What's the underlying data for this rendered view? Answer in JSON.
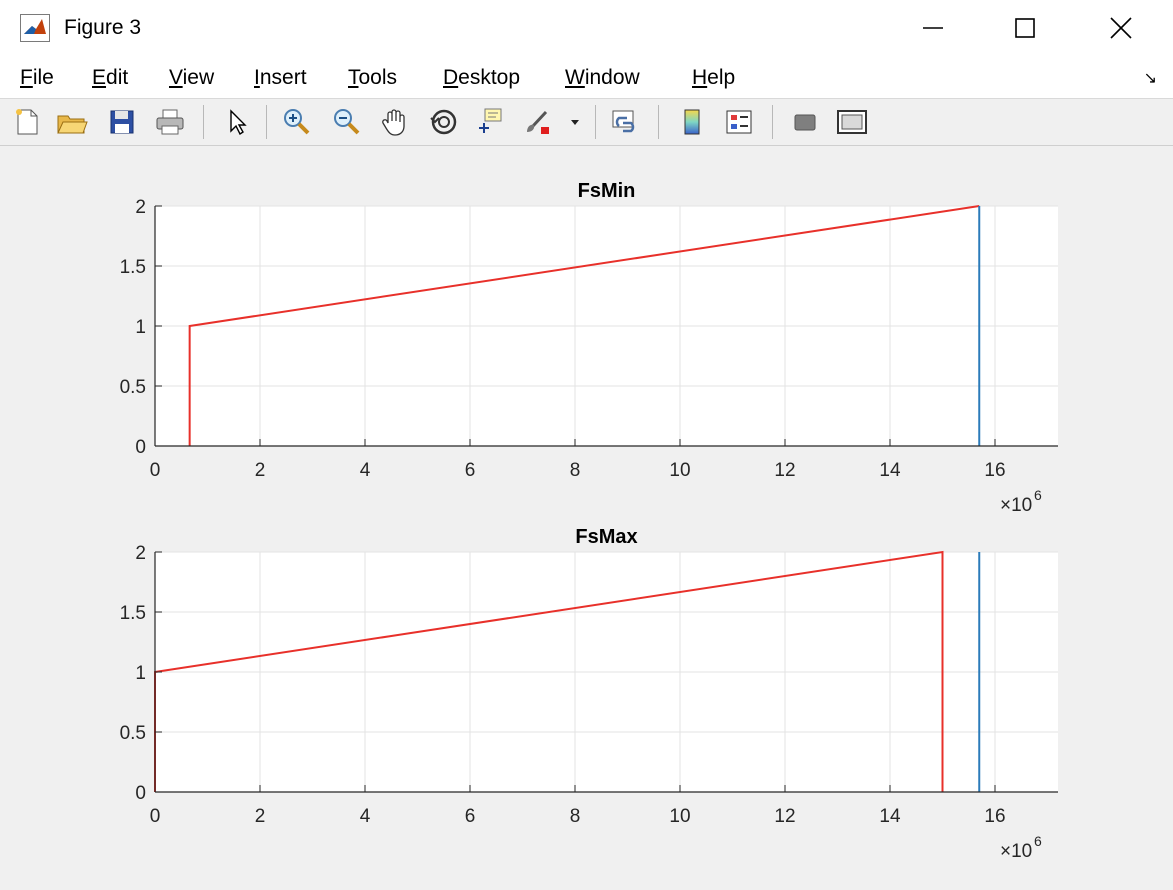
{
  "window": {
    "title": "Figure 3"
  },
  "menu": {
    "items": [
      {
        "first": "F",
        "rest": "ile"
      },
      {
        "first": "E",
        "rest": "dit"
      },
      {
        "first": "V",
        "rest": "iew"
      },
      {
        "first": "I",
        "rest": "nsert"
      },
      {
        "first": "T",
        "rest": "ools"
      },
      {
        "first": "D",
        "rest": "esktop"
      },
      {
        "first": "W",
        "rest": "indow"
      },
      {
        "first": "H",
        "rest": "elp"
      }
    ]
  },
  "toolbar": {
    "tools": [
      "new-figure-icon",
      "open-file-icon",
      "save-icon",
      "print-icon",
      "pointer-icon",
      "zoom-in-icon",
      "zoom-out-icon",
      "pan-hand-icon",
      "rotate-3d-icon",
      "data-cursor-icon",
      "brush-icon",
      "brush-dropdown-icon",
      "link-plot-icon",
      "colorbar-icon",
      "legend-icon",
      "hide-plot-tools-icon",
      "show-plot-tools-icon"
    ]
  },
  "colors": {
    "red_series": "#e8302a",
    "blue_series": "#2b7bba"
  },
  "chart_data": [
    {
      "type": "line",
      "title": "FsMin",
      "xlabel": "",
      "ylabel": "",
      "xlim": [
        0,
        17200000
      ],
      "ylim": [
        0,
        2
      ],
      "xticks": [
        0,
        2000000,
        4000000,
        6000000,
        8000000,
        10000000,
        12000000,
        14000000,
        16000000
      ],
      "xtick_labels": [
        "0",
        "2",
        "4",
        "6",
        "8",
        "10",
        "12",
        "14",
        "16"
      ],
      "yticks": [
        0,
        0.5,
        1,
        1.5,
        2
      ],
      "ytick_labels": [
        "0",
        "0.5",
        "1",
        "1.5",
        "2"
      ],
      "exponent_label": "×10",
      "exponent_power": "6",
      "grid": true,
      "series": [
        {
          "color": "red",
          "x": [
            660000,
            660000,
            15700000
          ],
          "y": [
            0,
            1,
            2
          ]
        },
        {
          "color": "blue",
          "x": [
            15700000,
            15700000
          ],
          "y": [
            0,
            2
          ]
        }
      ]
    },
    {
      "type": "line",
      "title": "FsMax",
      "xlabel": "",
      "ylabel": "",
      "xlim": [
        0,
        17200000
      ],
      "ylim": [
        0,
        2
      ],
      "xticks": [
        0,
        2000000,
        4000000,
        6000000,
        8000000,
        10000000,
        12000000,
        14000000,
        16000000
      ],
      "xtick_labels": [
        "0",
        "2",
        "4",
        "6",
        "8",
        "10",
        "12",
        "14",
        "16"
      ],
      "yticks": [
        0,
        0.5,
        1,
        1.5,
        2
      ],
      "ytick_labels": [
        "0",
        "0.5",
        "1",
        "1.5",
        "2"
      ],
      "exponent_label": "×10",
      "exponent_power": "6",
      "grid": true,
      "series": [
        {
          "color": "red",
          "x": [
            0,
            0,
            15000000,
            15000000
          ],
          "y": [
            0,
            1,
            2,
            0
          ]
        },
        {
          "color": "blue",
          "x": [
            15700000,
            15700000
          ],
          "y": [
            0,
            2
          ]
        }
      ]
    }
  ]
}
